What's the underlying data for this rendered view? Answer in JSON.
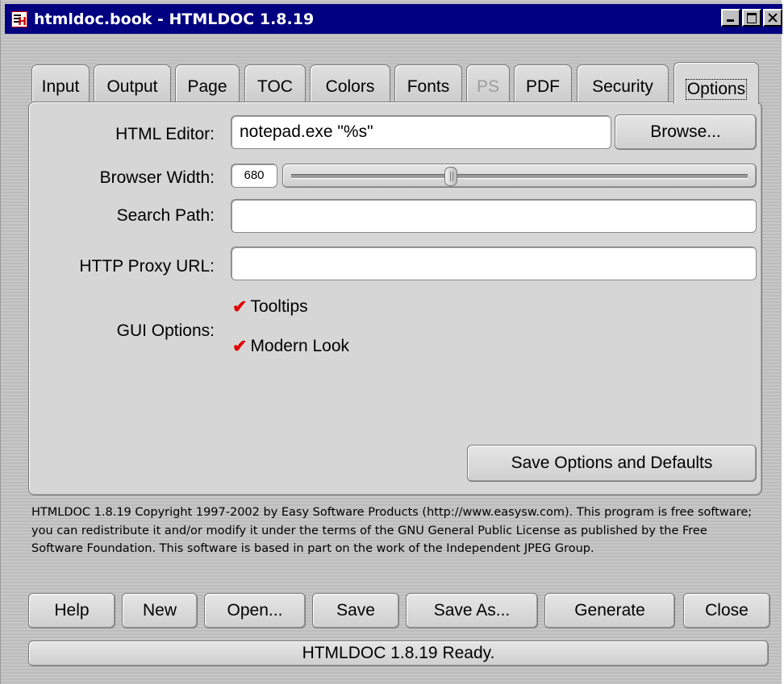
{
  "window": {
    "title": "htmldoc.book - HTMLDOC 1.8.19"
  },
  "tabs": [
    {
      "label": "Input",
      "disabled": false
    },
    {
      "label": "Output",
      "disabled": false
    },
    {
      "label": "Page",
      "disabled": false
    },
    {
      "label": "TOC",
      "disabled": false
    },
    {
      "label": "Colors",
      "disabled": false
    },
    {
      "label": "Fonts",
      "disabled": false
    },
    {
      "label": "PS",
      "disabled": true
    },
    {
      "label": "PDF",
      "disabled": false
    },
    {
      "label": "Security",
      "disabled": false
    },
    {
      "label": "Options",
      "disabled": false,
      "active": true
    }
  ],
  "options": {
    "html_editor_label": "HTML Editor:",
    "html_editor_value": "notepad.exe \"%s\"",
    "browse_label": "Browse...",
    "browser_width_label": "Browser Width:",
    "browser_width_value": "680",
    "browser_width_fraction": 0.35,
    "search_path_label": "Search Path:",
    "search_path_value": "",
    "proxy_label": "HTTP Proxy URL:",
    "proxy_value": "",
    "gui_options_label": "GUI Options:",
    "tooltips_label": "Tooltips",
    "tooltips_checked": true,
    "modern_look_label": "Modern Look",
    "modern_look_checked": true,
    "save_button_label": "Save Options and Defaults"
  },
  "footer": {
    "copyright": "HTMLDOC 1.8.19 Copyright 1997-2002 by Easy Software Products (http://www.easysw.com). This program is free software; you can redistribute it and/or modify it under the terms of the GNU General Public License as published by the Free Software Foundation. This software is based in part on the work of the Independent JPEG Group."
  },
  "buttons": {
    "help": "Help",
    "new": "New",
    "open": "Open...",
    "save": "Save",
    "save_as": "Save As...",
    "generate": "Generate",
    "close": "Close"
  },
  "status": {
    "text": "HTMLDOC 1.8.19 Ready."
  },
  "icons": {
    "app": "htmldoc-icon",
    "check": "checkmark-icon"
  },
  "colors": {
    "titlebar": "#000080",
    "checkmark": "#e00000"
  }
}
